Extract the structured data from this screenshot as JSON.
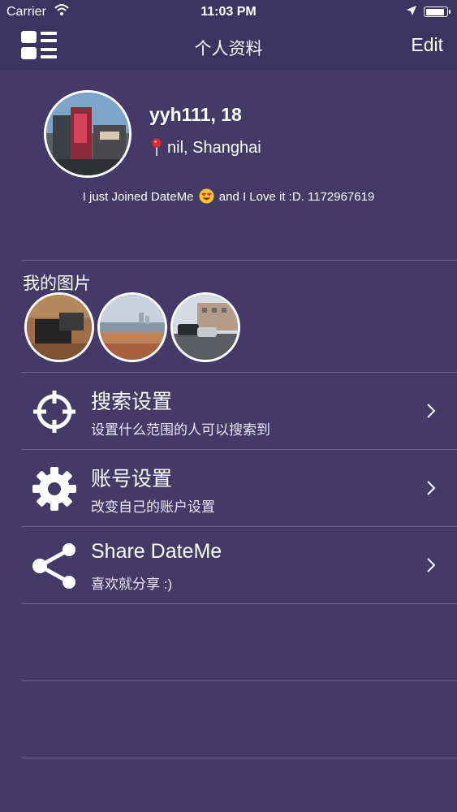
{
  "status_bar": {
    "carrier": "Carrier",
    "time": "11:03 PM",
    "battery_level": 0.92
  },
  "nav": {
    "title": "个人资料",
    "edit_label": "Edit"
  },
  "profile": {
    "name": "yyh111, 18",
    "location": "nil, Shanghai",
    "bio_before": "I just Joined DateMe",
    "bio_after": "and I Love it :D.  1172967619"
  },
  "photos": {
    "title": "我的图片",
    "items": [
      "photo-1",
      "photo-2",
      "photo-3"
    ]
  },
  "menu": [
    {
      "label": "搜索设置",
      "sub": "设置什么范围的人可以搜索到",
      "icon": "crosshair-icon"
    },
    {
      "label": "账号设置",
      "sub": "改变自己的账户设置",
      "icon": "gear-icon"
    },
    {
      "label": "Share DateMe",
      "sub": "喜欢就分享 :)",
      "icon": "share-icon"
    }
  ],
  "colors": {
    "background": "#433a68",
    "bar": "#3b3460",
    "divider": "#6e6892"
  }
}
